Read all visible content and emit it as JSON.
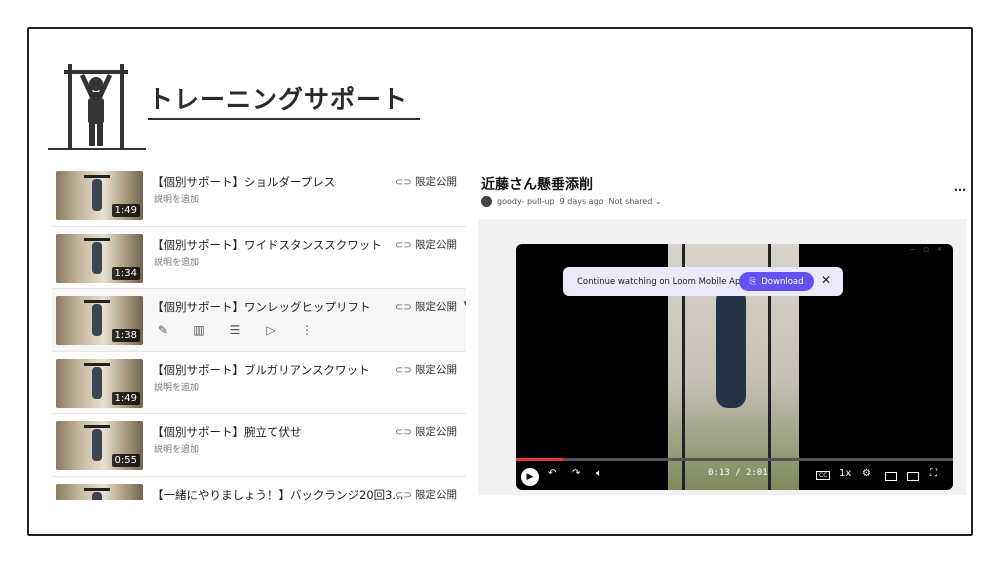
{
  "page": {
    "title": "トレーニングサポート"
  },
  "videos": [
    {
      "title": "【個別サポート】ショルダープレス",
      "desc": "説明を追加",
      "duration": "1:49",
      "visibility": "限定公開"
    },
    {
      "title": "【個別サポート】ワイドスタンススクワット",
      "desc": "説明を追加",
      "duration": "1:34",
      "visibility": "限定公開"
    },
    {
      "title": "【個別サポート】ワンレッグヒップリフト",
      "desc": "",
      "duration": "1:38",
      "visibility": "限定公開"
    },
    {
      "title": "【個別サポート】ブルガリアンスクワット",
      "desc": "説明を追加",
      "duration": "1:49",
      "visibility": "限定公開"
    },
    {
      "title": "【個別サポート】腕立て伏せ",
      "desc": "説明を追加",
      "duration": "0:55",
      "visibility": "限定公開"
    },
    {
      "title": "【一緒にやりましょう！】バックランジ20回3...",
      "desc": "",
      "duration": "",
      "visibility": "限定公開"
    }
  ],
  "row_actions": [
    "pencil-icon",
    "analytics-icon",
    "comments-icon",
    "youtube-icon",
    "more-vert-icon"
  ],
  "loom": {
    "title": "近藤さん懸垂添削",
    "author": "goody- pull-up",
    "age": "9 days ago",
    "share": "Not shared",
    "more": "…",
    "banner_text": "Continue watching on Loom Mobile App",
    "download": "Download",
    "current_time": "0:13",
    "total_time": "2:01",
    "time_sep": "/",
    "speed": "1x",
    "progress": 0.107
  },
  "colors": {
    "accent": "#6551f3",
    "progress": "#e53935"
  }
}
